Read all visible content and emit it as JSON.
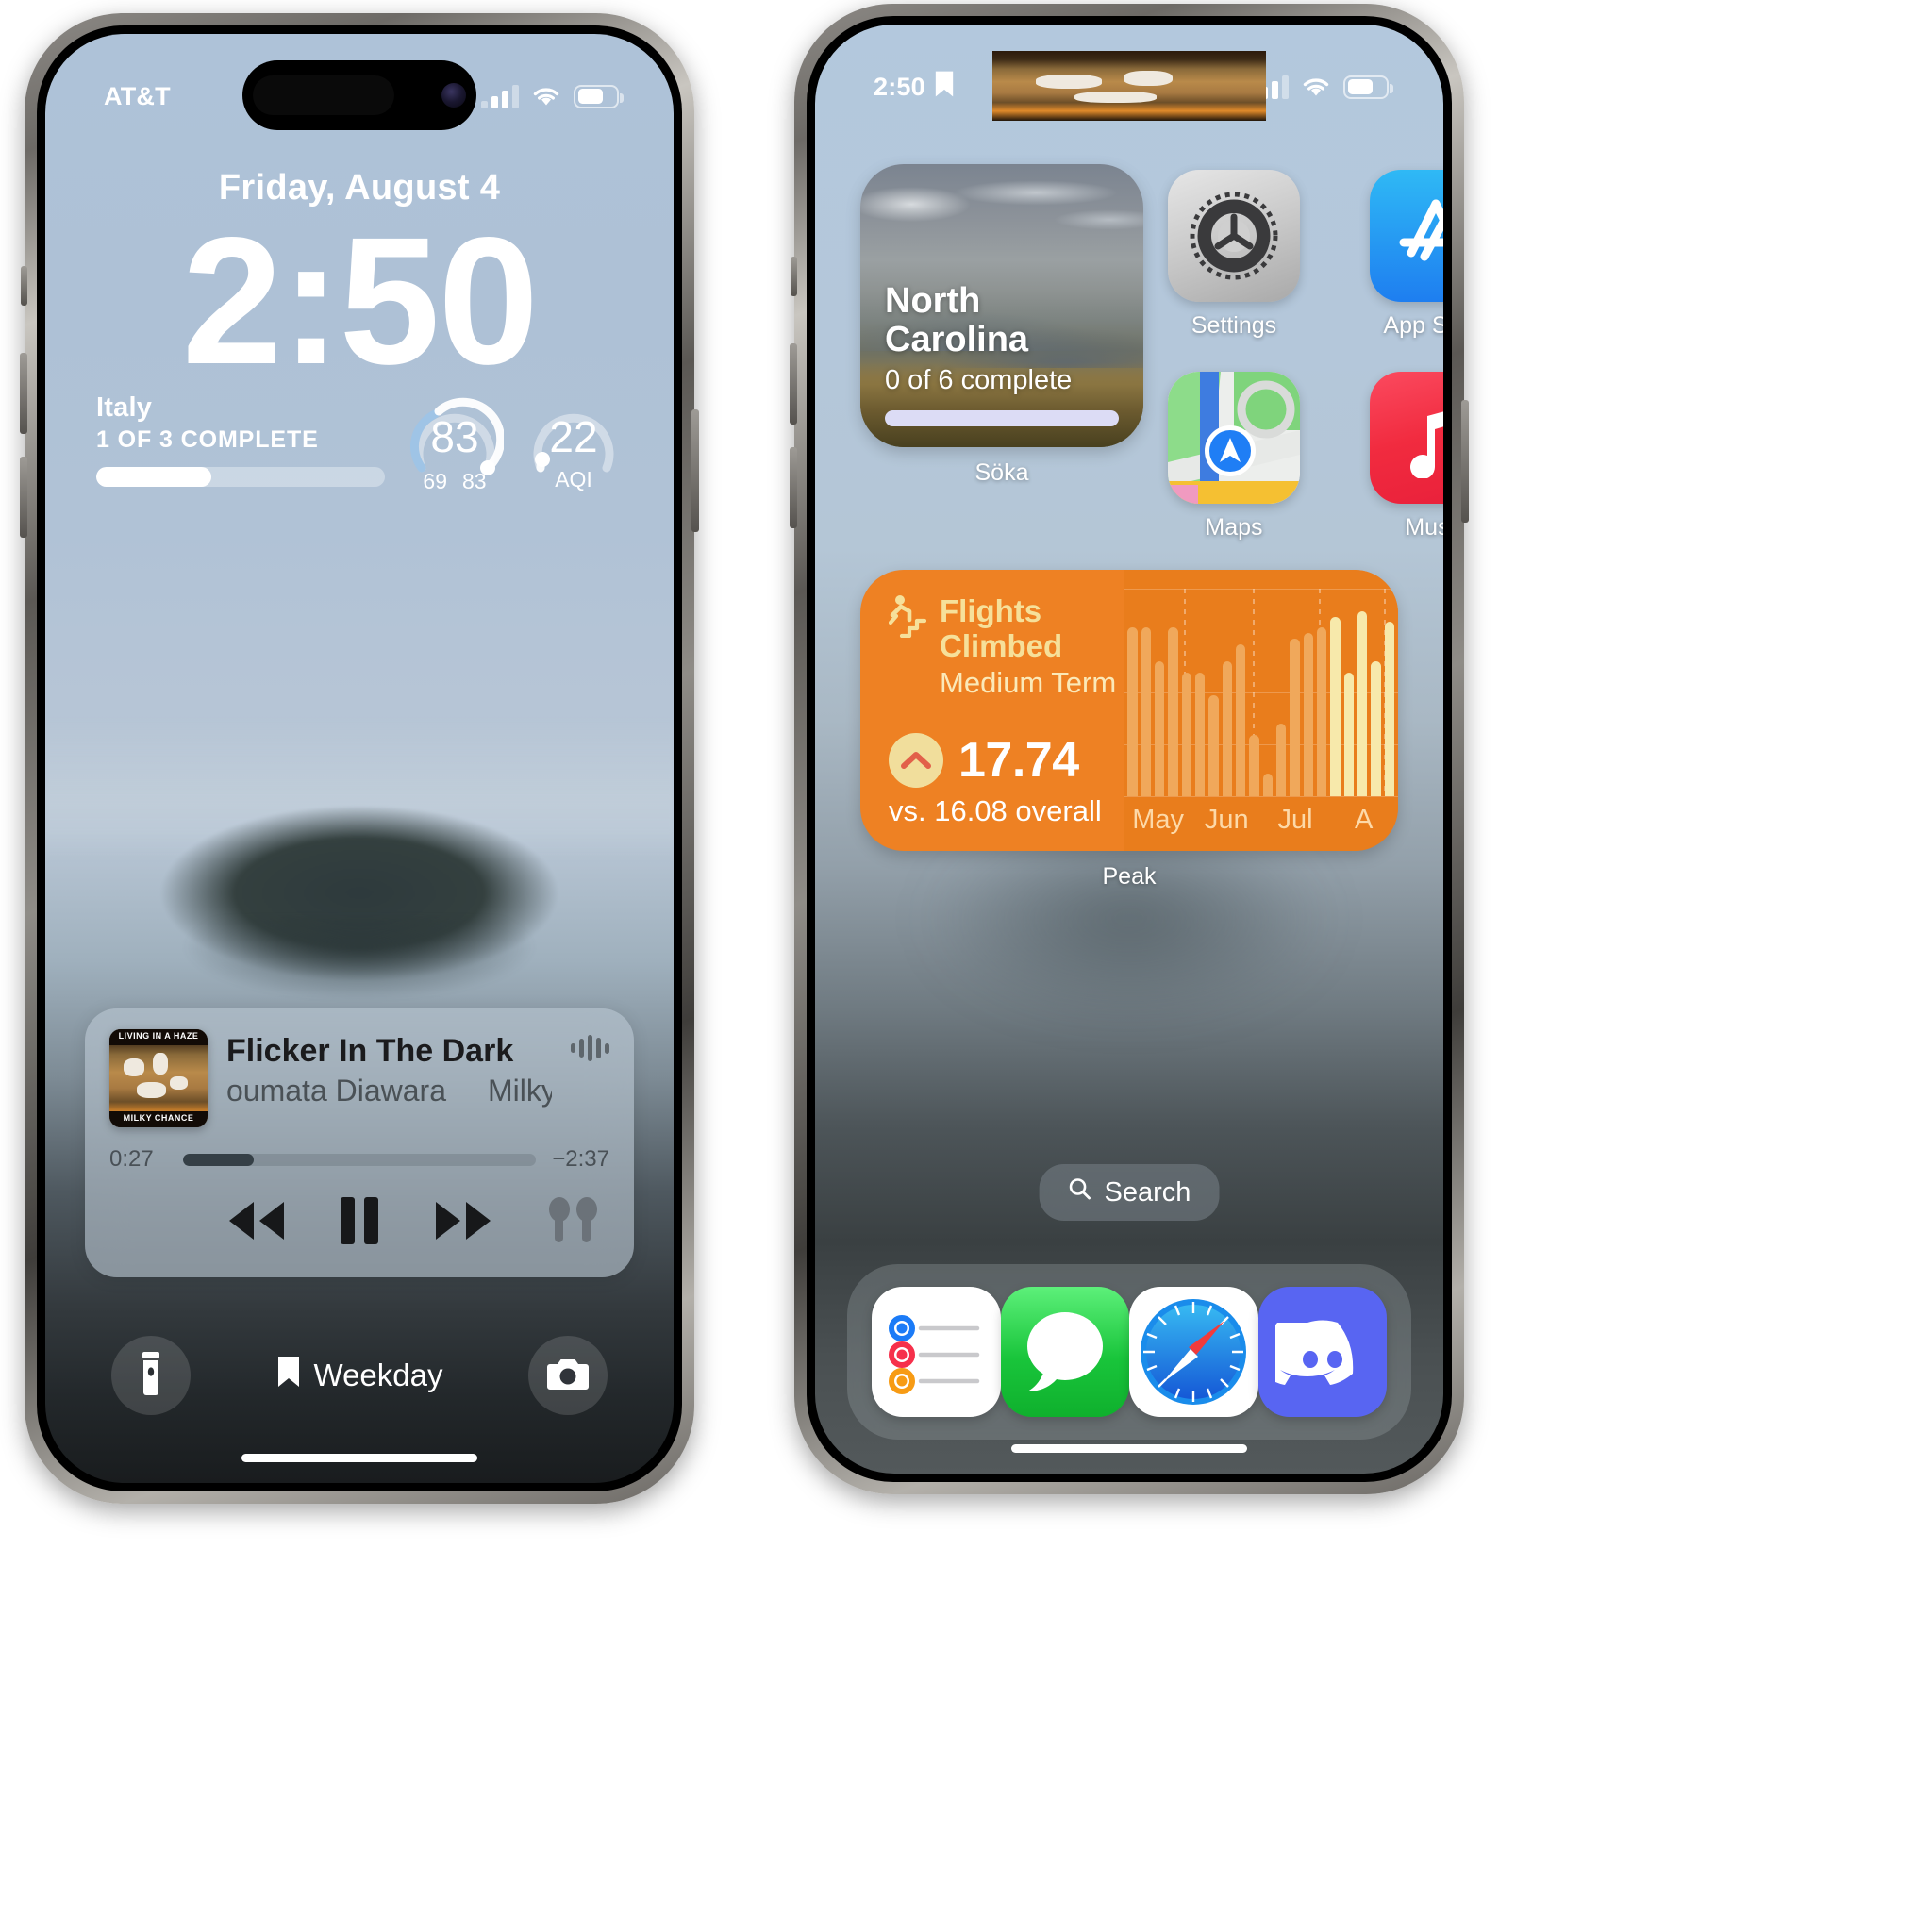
{
  "lock_screen": {
    "status": {
      "carrier": "AT&T",
      "signal_icon": "cellular-bars-icon",
      "wifi_icon": "wifi-icon",
      "battery_icon": "battery-icon"
    },
    "date": "Friday, August 4",
    "time": "2:50",
    "activity_widget": {
      "title": "Italy",
      "subtitle": "1 OF 3 COMPLETE",
      "progress_percent": 40
    },
    "gauge_left": {
      "value": "83",
      "min_label": "69",
      "max_label": "83",
      "progress_percent": 72
    },
    "gauge_right": {
      "value": "22",
      "unit_label": "AQI",
      "progress_percent": 12
    },
    "now_playing": {
      "title": "Flicker In The Dark",
      "artist_part1": "oumata Diawara",
      "artist_part2": "Milky Chance &",
      "elapsed": "0:27",
      "remaining": "−2:37",
      "progress_percent": 20,
      "rewind_icon": "rewind-icon",
      "pause_icon": "pause-icon",
      "forward_icon": "fast-forward-icon",
      "airpods_icon": "airpods-icon",
      "waveform_icon": "waveform-icon",
      "album_art_icon": "album-artwork-living-in-a-haze",
      "album_art_top_text": "LIVING IN A HAZE",
      "album_art_bottom_text": "MILKY CHANCE"
    },
    "bottom": {
      "flashlight_icon": "flashlight-icon",
      "camera_icon": "camera-icon",
      "focus_icon": "bookmark-icon",
      "focus_label": "Weekday"
    }
  },
  "home_screen": {
    "status": {
      "time": "2:50",
      "focus_icon": "bookmark-icon",
      "signal_icon": "cellular-bars-icon",
      "wifi_icon": "wifi-icon",
      "battery_icon": "battery-icon",
      "island_waveform_icon": "audio-waveform-icon",
      "island_album_icon": "album-artwork-thumbnail"
    },
    "widgets": {
      "soka": {
        "title_line1": "North",
        "title_line2": "Carolina",
        "subtitle": "0 of 6 complete",
        "progress_percent": 100,
        "app_label": "Söka"
      },
      "peak": {
        "metric_title": "Flights Climbed",
        "metric_subtitle": "Medium Term",
        "stairs_icon": "stairs-climb-icon",
        "trend_icon": "chevron-up-icon",
        "value": "17.74",
        "comparison": "vs. 16.08 overall",
        "app_label": "Peak"
      }
    },
    "apps": [
      {
        "name": "Settings",
        "icon": "settings-gear-icon"
      },
      {
        "name": "App Store",
        "icon": "app-store-icon"
      },
      {
        "name": "Maps",
        "icon": "maps-icon"
      },
      {
        "name": "Music",
        "icon": "music-note-icon"
      }
    ],
    "search": {
      "label": "Search",
      "icon": "search-icon"
    },
    "dock": [
      {
        "name": "Reminders",
        "icon": "reminders-icon"
      },
      {
        "name": "Messages",
        "icon": "messages-bubble-icon"
      },
      {
        "name": "Safari",
        "icon": "safari-compass-icon"
      },
      {
        "name": "Discord",
        "icon": "discord-icon"
      }
    ]
  },
  "chart_data": {
    "type": "bar",
    "title": "Flights Climbed",
    "subtitle": "Medium Term",
    "categories": [
      "May",
      "Jun",
      "Jul",
      "A"
    ],
    "xlabel": "",
    "ylabel": "",
    "grid": true,
    "legend": "none",
    "current_value": 17.74,
    "overall_average": 16.08,
    "values": [
      30,
      30,
      24,
      30,
      22,
      22,
      18,
      24,
      27,
      11,
      4,
      13,
      28,
      29,
      30,
      32,
      22,
      33,
      24,
      31
    ],
    "highlight_from_index": 15,
    "highlight_color": "#f7e9ab",
    "bar_color": "#f0a85b",
    "background_color": "#e97d1c"
  }
}
